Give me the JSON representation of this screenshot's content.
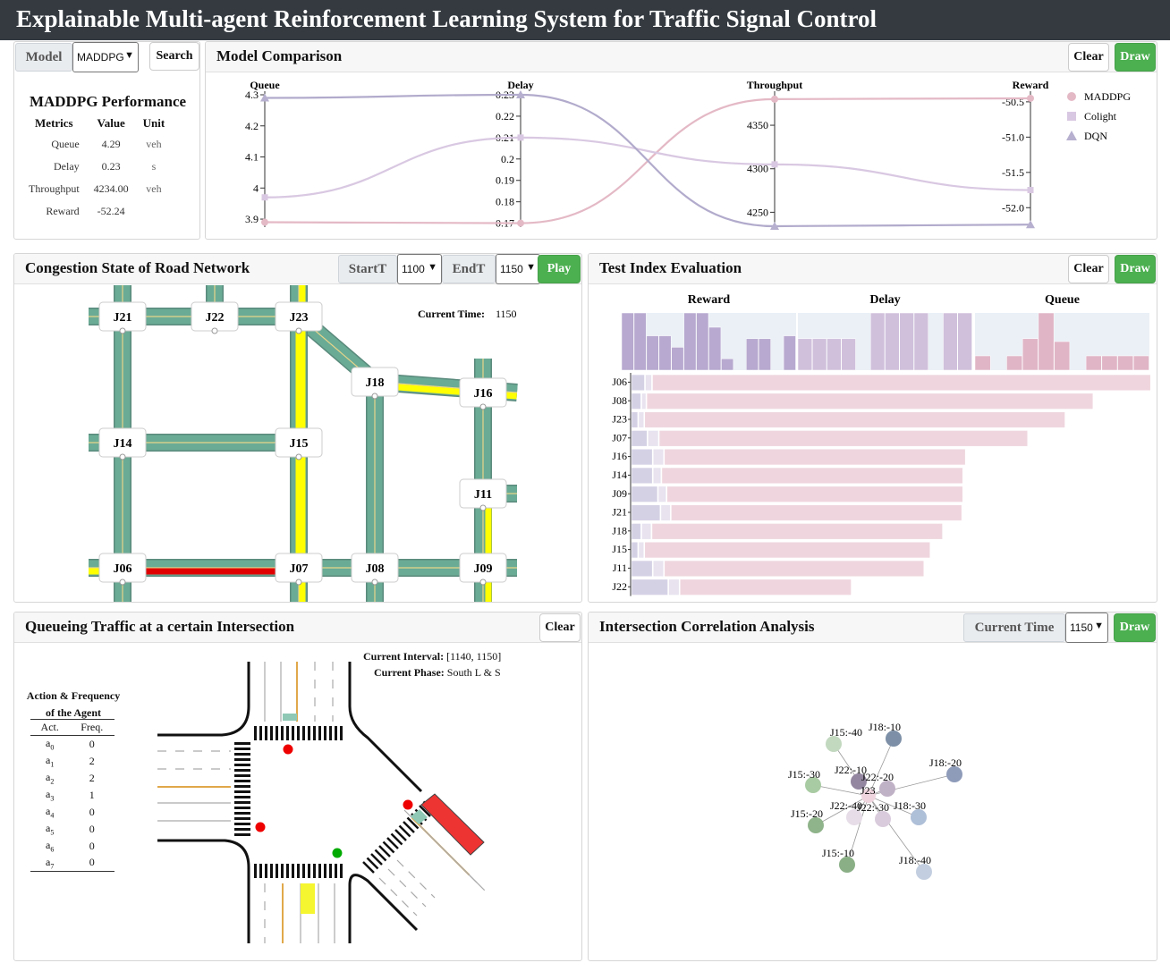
{
  "app": {
    "title": "Explainable Multi-agent Reinforcement Learning System for Traffic Signal Control"
  },
  "model_panel": {
    "model_label": "Model",
    "model_value": "MADDPG",
    "search_label": "Search",
    "perf_title": "MADDPG Performance",
    "headers": [
      "Metrics",
      "Value",
      "Unit"
    ],
    "rows": [
      [
        "Queue",
        "4.29",
        "veh"
      ],
      [
        "Delay",
        "0.23",
        "s"
      ],
      [
        "Throughput",
        "4234.00",
        "veh"
      ],
      [
        "Reward",
        "-52.24",
        ""
      ]
    ]
  },
  "comparison": {
    "title": "Model Comparison",
    "clear_label": "Clear",
    "draw_label": "Draw",
    "axes": [
      {
        "name": "Queue",
        "ticks": [
          "4.3",
          "4.2",
          "4.1",
          "4",
          "3.9"
        ],
        "min": 3.88,
        "max": 4.3
      },
      {
        "name": "Delay",
        "ticks": [
          "0.23",
          "0.22",
          "0.21",
          "0.2",
          "0.19",
          "0.18",
          "0.17"
        ],
        "min": 0.169,
        "max": 0.23
      },
      {
        "name": "Throughput",
        "ticks": [
          "4350",
          "4300",
          "4250"
        ],
        "min": 4235,
        "max": 4385
      },
      {
        "name": "Reward",
        "ticks": [
          "-50.5",
          "-51.0",
          "-51.5",
          "-52.0"
        ],
        "min": -52.25,
        "max": -50.4
      }
    ],
    "legend": [
      {
        "name": "MADDPG",
        "color": "#e4b9c6",
        "marker": "circle"
      },
      {
        "name": "Colight",
        "color": "#d9c8e2",
        "marker": "square"
      },
      {
        "name": "DQN",
        "color": "#b7b0cf",
        "marker": "triangle"
      }
    ],
    "series": [
      {
        "name": "MADDPG",
        "values": [
          3.89,
          0.17,
          4380,
          -50.45
        ]
      },
      {
        "name": "Colight",
        "values": [
          3.97,
          0.21,
          4305,
          -51.75
        ]
      },
      {
        "name": "DQN",
        "values": [
          4.29,
          0.23,
          4234,
          -52.24
        ]
      }
    ]
  },
  "congestion": {
    "title": "Congestion State of Road Network",
    "start_label": "StartT",
    "start_value": "1100",
    "end_label": "EndT",
    "end_value": "1150",
    "play_label": "Play",
    "current_time_label": "Current Time:",
    "current_time_value": "1150",
    "junctions": [
      "J21",
      "J22",
      "J23",
      "J18",
      "J16",
      "J14",
      "J15",
      "J11",
      "J06",
      "J07",
      "J08",
      "J09"
    ],
    "colors": {
      "free": "#6aab95",
      "slow": "#ffff00",
      "jam": "#e00000"
    }
  },
  "test_index": {
    "title": "Test Index Evaluation",
    "clear_label": "Clear",
    "draw_label": "Draw",
    "column_titles": [
      "Reward",
      "Delay",
      "Queue"
    ],
    "rows": [
      "J06",
      "J08",
      "J23",
      "J07",
      "J16",
      "J14",
      "J09",
      "J21",
      "J18",
      "J15",
      "J11",
      "J22"
    ],
    "reward_bars": [
      1.0,
      1.0,
      0.6,
      0.6,
      0.4,
      1.0,
      1.0,
      0.75,
      0.2,
      0.0,
      0.55,
      0.55,
      0.0,
      0.6
    ],
    "delay_bars": [
      0.55,
      0.55,
      0.55,
      0.55,
      0.0,
      1.0,
      1.0,
      1.0,
      1.0,
      0.0,
      1.0,
      1.0
    ],
    "queue_bars": [
      0.25,
      0.0,
      0.25,
      0.55,
      1.0,
      0.5,
      0.0,
      0.25,
      0.25,
      0.25,
      0.25
    ],
    "stack_segments": [
      [
        [
          0.025,
          "#d5d1e5"
        ],
        [
          0.012,
          "#e8e3ef"
        ],
        [
          0.96,
          "#efd6de"
        ]
      ],
      [
        [
          0.018,
          "#d5d1e5"
        ],
        [
          0.008,
          "#e8e3ef"
        ],
        [
          0.86,
          "#efd6de"
        ]
      ],
      [
        [
          0.012,
          "#d5d1e5"
        ],
        [
          0.01,
          "#e8e3ef"
        ],
        [
          0.81,
          "#efd6de"
        ]
      ],
      [
        [
          0.03,
          "#d5d1e5"
        ],
        [
          0.02,
          "#e8e3ef"
        ],
        [
          0.71,
          "#efd6de"
        ]
      ],
      [
        [
          0.04,
          "#d5d1e5"
        ],
        [
          0.02,
          "#e8e3ef"
        ],
        [
          0.58,
          "#efd6de"
        ]
      ],
      [
        [
          0.04,
          "#d5d1e5"
        ],
        [
          0.015,
          "#e8e3ef"
        ],
        [
          0.58,
          "#efd6de"
        ]
      ],
      [
        [
          0.05,
          "#d5d1e5"
        ],
        [
          0.015,
          "#e8e3ef"
        ],
        [
          0.57,
          "#efd6de"
        ]
      ],
      [
        [
          0.055,
          "#d5d1e5"
        ],
        [
          0.018,
          "#e8e3ef"
        ],
        [
          0.56,
          "#efd6de"
        ]
      ],
      [
        [
          0.018,
          "#d5d1e5"
        ],
        [
          0.018,
          "#e8e3ef"
        ],
        [
          0.56,
          "#efd6de"
        ]
      ],
      [
        [
          0.012,
          "#d5d1e5"
        ],
        [
          0.01,
          "#e8e3ef"
        ],
        [
          0.55,
          "#efd6de"
        ]
      ],
      [
        [
          0.04,
          "#d5d1e5"
        ],
        [
          0.02,
          "#e8e3ef"
        ],
        [
          0.5,
          "#efd6de"
        ]
      ],
      [
        [
          0.07,
          "#d5d1e5"
        ],
        [
          0.02,
          "#e8e3ef"
        ],
        [
          0.33,
          "#efd6de"
        ]
      ]
    ]
  },
  "queueing": {
    "title": "Queueing Traffic at a certain Intersection",
    "clear_label": "Clear",
    "interval_label": "Current Interval:",
    "interval_value": "[1140, 1150]",
    "phase_label": "Current Phase:",
    "phase_value": "South L & S",
    "table_title_1": "Action & Frequency",
    "table_title_2": "of the Agent",
    "table_headers": [
      "Act.",
      "Freq."
    ],
    "actions": [
      {
        "a": "a",
        "sub": "0",
        "freq": "0"
      },
      {
        "a": "a",
        "sub": "1",
        "freq": "2"
      },
      {
        "a": "a",
        "sub": "2",
        "freq": "2"
      },
      {
        "a": "a",
        "sub": "3",
        "freq": "1"
      },
      {
        "a": "a",
        "sub": "4",
        "freq": "0"
      },
      {
        "a": "a",
        "sub": "5",
        "freq": "0"
      },
      {
        "a": "a",
        "sub": "6",
        "freq": "0"
      },
      {
        "a": "a",
        "sub": "7",
        "freq": "0"
      }
    ]
  },
  "correlation": {
    "title": "Intersection Correlation Analysis",
    "current_time_label": "Current Time",
    "current_time_value": "1150",
    "draw_label": "Draw",
    "center_label": "J23",
    "nodes": [
      {
        "label": "J15:-40",
        "color": "#c2d8bf"
      },
      {
        "label": "J18:-10",
        "color": "#7c8fa6"
      },
      {
        "label": "J22:-10",
        "color": "#9386a0"
      },
      {
        "label": "J22:-20",
        "color": "#c0b2c6"
      },
      {
        "label": "J18:-20",
        "color": "#8e9bb9"
      },
      {
        "label": "J15:-30",
        "color": "#a9cba3"
      },
      {
        "label": "J22:-40",
        "color": "#e6dde8"
      },
      {
        "label": "J22:-30",
        "color": "#d9cbdc"
      },
      {
        "label": "J18:-30",
        "color": "#aebfd8"
      },
      {
        "label": "J15:-20",
        "color": "#8fb38a"
      },
      {
        "label": "J15:-10",
        "color": "#8aaf86"
      },
      {
        "label": "J18:-40",
        "color": "#c3cfe0"
      }
    ]
  }
}
